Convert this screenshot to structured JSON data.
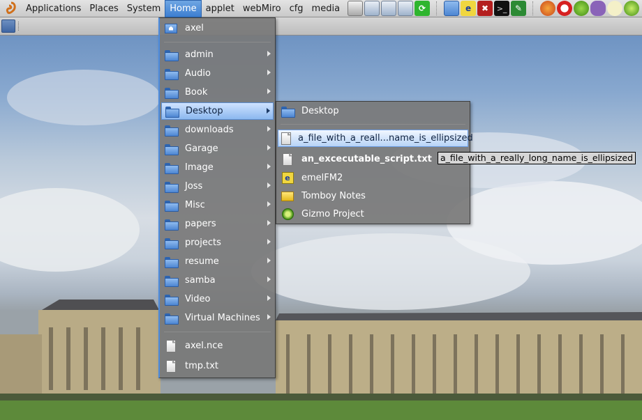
{
  "top_panel": {
    "menus": [
      "Applications",
      "Places",
      "System",
      "Home",
      "applet",
      "webMiro",
      "cfg",
      "media"
    ],
    "active_menu": "Home"
  },
  "home_menu": {
    "home_item": "axel",
    "folders": [
      "admin",
      "Audio",
      "Book",
      "Desktop",
      "downloads",
      "Garage",
      "Image",
      "Joss",
      "Misc",
      "papers",
      "projects",
      "resume",
      "samba",
      "Video",
      "Virtual Machines"
    ],
    "files": [
      "axel.nce",
      "tmp.txt"
    ]
  },
  "desktop_menu": {
    "header": "Desktop",
    "items": [
      {
        "label": "a_file_with_a_reall...name_is_ellipsized",
        "icon": "document-icon"
      },
      {
        "label": "an_excecutable_script.txt",
        "icon": "document-icon"
      },
      {
        "label": "emelFM2",
        "icon": "emelfm2-icon"
      },
      {
        "label": "Tomboy Notes",
        "icon": "tomboy-notes-icon"
      },
      {
        "label": "Gizmo Project",
        "icon": "gizmo-icon"
      }
    ]
  },
  "tooltip": "a_file_with_a_really_long_name_is_ellipsized"
}
